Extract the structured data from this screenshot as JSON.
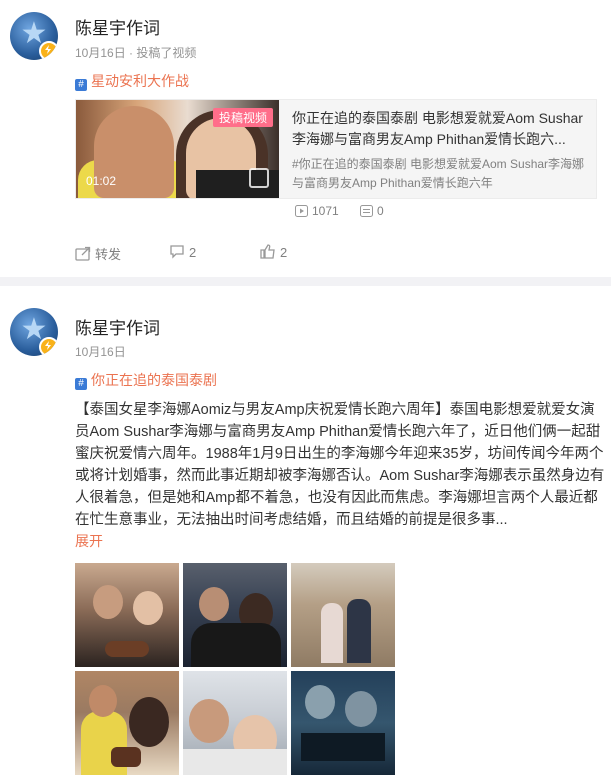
{
  "post1": {
    "author": "陈星宇作词",
    "meta": "10月16日 · 投稿了视频",
    "topic": "星动安利大作战",
    "embed": {
      "tag": "投稿视频",
      "duration": "01:02",
      "title": "你正在追的泰国泰剧 电影想爱就爱Aom Sushar李海娜与富商男友Amp Phithan爱情长跑六...",
      "desc": "#你正在追的泰国泰剧 电影想爱就爱Aom Sushar李海娜与富商男友Amp Phithan爱情长跑六年",
      "plays": "1071",
      "comments": "0"
    },
    "actions": {
      "repost": "转发",
      "comment": "2",
      "like": "2"
    }
  },
  "post2": {
    "author": "陈星宇作词",
    "meta": "10月16日",
    "topic": "你正在追的泰国泰剧",
    "body": "【泰国女星李海娜Aomiz与男友Amp庆祝爱情长跑六周年】泰国电影想爱就爱女演员Aom Sushar李海娜与富商男友Amp Phithan爱情长跑六年了，近日他们俩一起甜蜜庆祝爱情六周年。1988年1月9日出生的李海娜今年迎来35岁，坊间传闻今年两个或将计划婚事，然而此事近期却被李海娜否认。Aom Sushar李海娜表示虽然身边有人很着急，但是她和Amp都不着急，也没有因此而焦虑。李海娜坦言两个人最近都在忙生意事业，无法抽出时间考虑结婚，而且结婚的前提是很多事...",
    "expand": "展开"
  },
  "colors": {
    "accent": "#eb7350",
    "topic_icon": "#3b7bd6",
    "meta": "#939393",
    "separator": "#f2f2f5"
  },
  "icons": [
    "star-avatar-icon",
    "verified-badge-icon",
    "topic-hash-icon",
    "play-count-icon",
    "comment-count-icon",
    "repost-icon",
    "comment-icon",
    "like-icon"
  ]
}
